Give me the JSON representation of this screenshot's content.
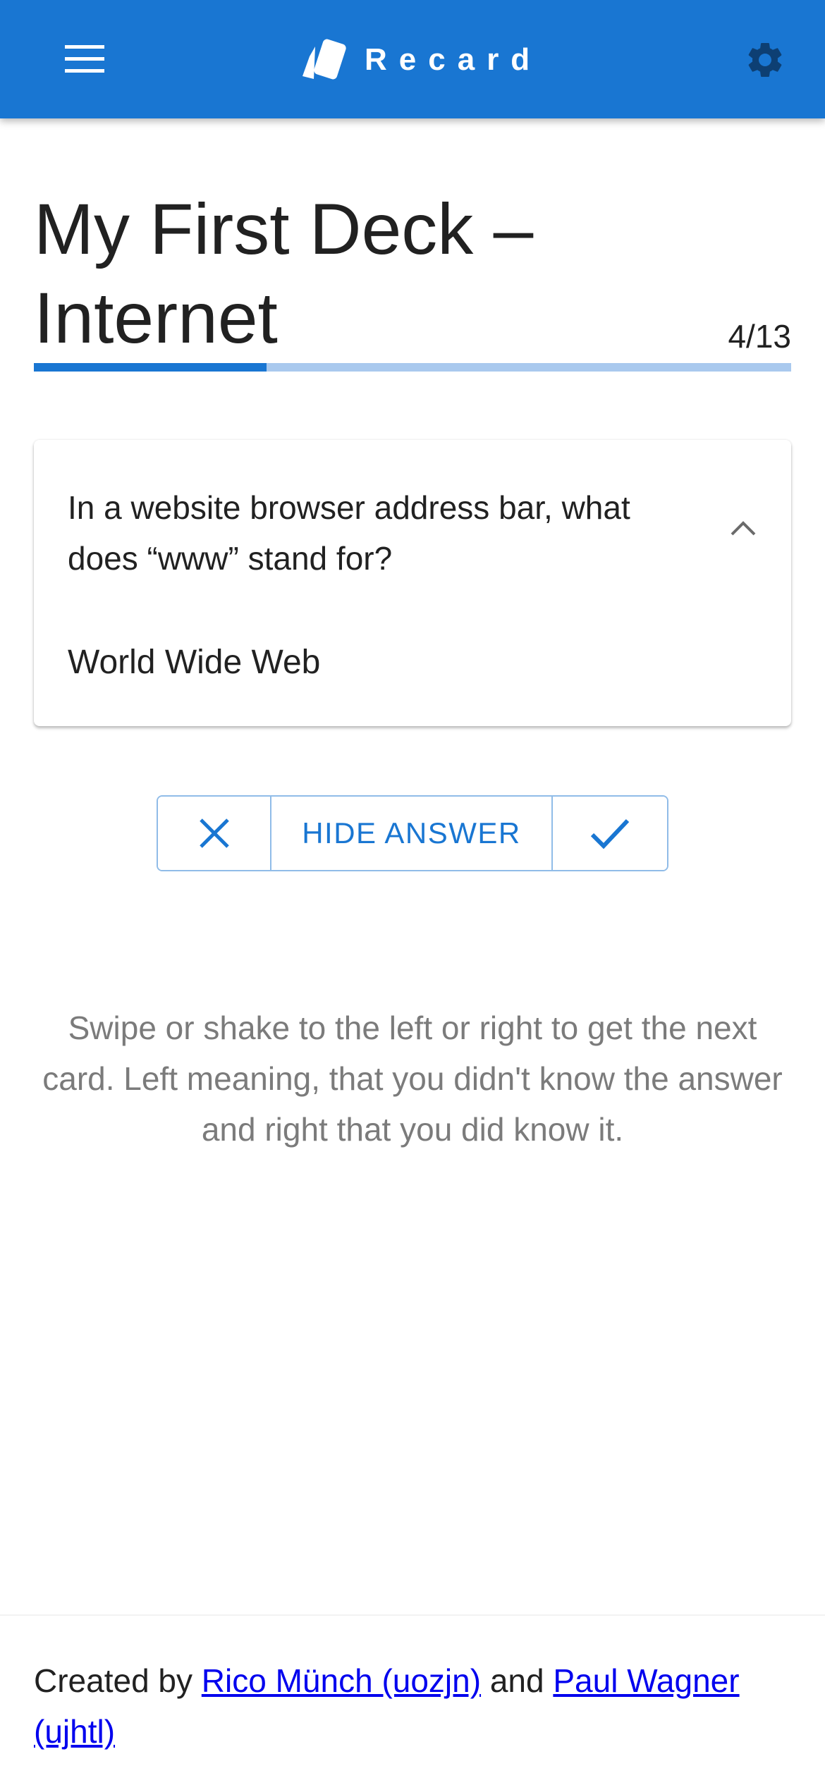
{
  "app": {
    "name": "Recard",
    "accent_color": "#1976d2",
    "icons": {
      "menu": "hamburger-menu-icon",
      "logo": "cards-logo-icon",
      "settings": "gear-icon",
      "collapse": "chevron-up-icon",
      "wrong": "close-icon",
      "right": "check-icon"
    }
  },
  "deck": {
    "title": "My First Deck – Internet",
    "progress_text": "4/13",
    "progress_fraction": 0.3077
  },
  "card": {
    "question": "In a website browser address bar, what does “www” stand for?",
    "answer": "World Wide Web"
  },
  "actions": {
    "toggle_label": "HIDE ANSWER"
  },
  "hint": "Swipe or shake to the left or right to get the next card. Left meaning, that you didn't know the answer and right that you did know it.",
  "footer": {
    "prefix": "Created by ",
    "author1": "Rico Münch (uozjn)",
    "conjunction": " and ",
    "author2": "Paul Wagner (ujhtl)"
  }
}
